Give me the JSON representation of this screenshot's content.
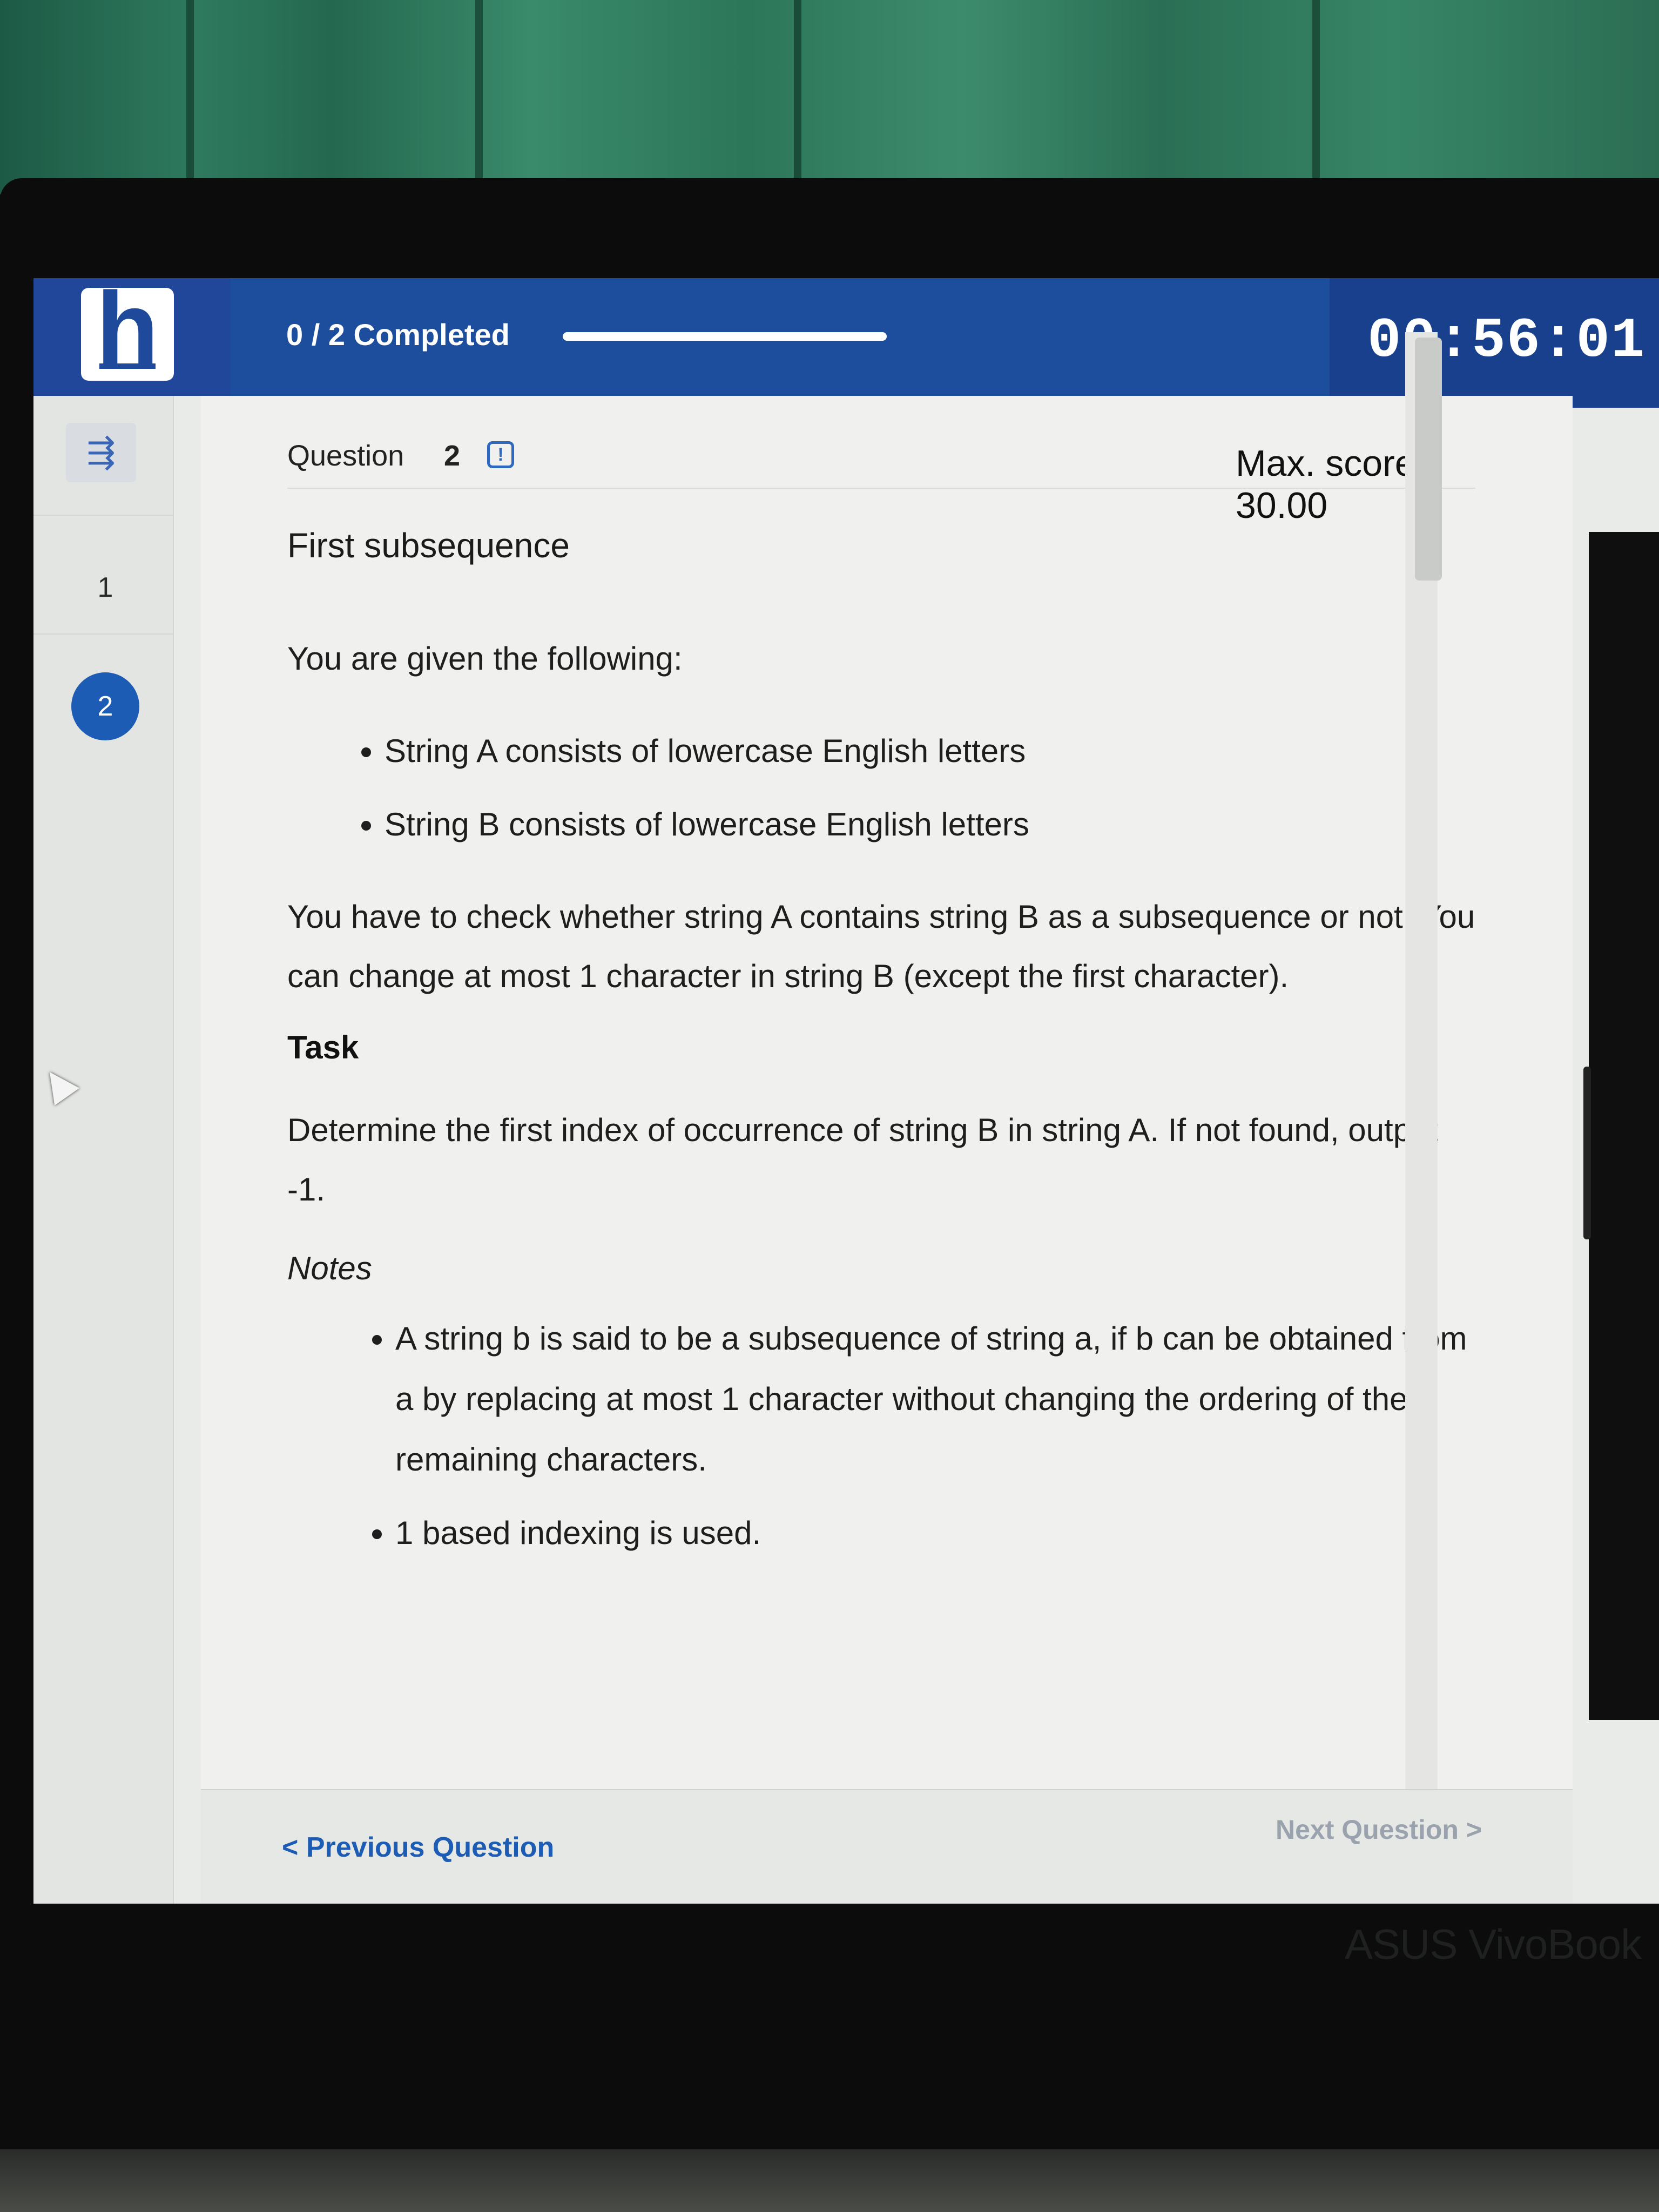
{
  "header": {
    "progress_text": "0 / 2 Completed",
    "progress_fraction": 0.0,
    "timer": "00:56:01",
    "logo_letter": "h",
    "colors": {
      "bar": "#1d4e9e",
      "timer_bg": "#18408c",
      "accent": "#1d5cb5"
    }
  },
  "sidebar": {
    "menu_icon": "expand-menu-icon",
    "questions": [
      {
        "label": "1",
        "active": false
      },
      {
        "label": "2",
        "active": true
      }
    ]
  },
  "question": {
    "label": "Question",
    "number": "2",
    "max_score": "Max. score: 30.00",
    "title": "First subsequence",
    "intro": "You are given the following:",
    "given": [
      "String A consists of lowercase English letters",
      "String B consists of lowercase English letters"
    ],
    "description": "You have to check whether string A contains string B as a subsequence or not. You can change at most 1 character in string B (except the first character).",
    "task_heading": "Task",
    "task_text": "Determine the first index of occurrence of string B in string A. If not found, output -1.",
    "notes_heading": "Notes",
    "notes": [
      "A string b is said to be a subsequence of string a, if b can be obtained from a by replacing at most 1 character without changing the ordering of the remaining characters.",
      "1 based indexing is used."
    ]
  },
  "footer": {
    "prev_label": "< Previous Question",
    "next_label": "Next Question >"
  },
  "device": {
    "brand": "ASUS VivoBook"
  }
}
